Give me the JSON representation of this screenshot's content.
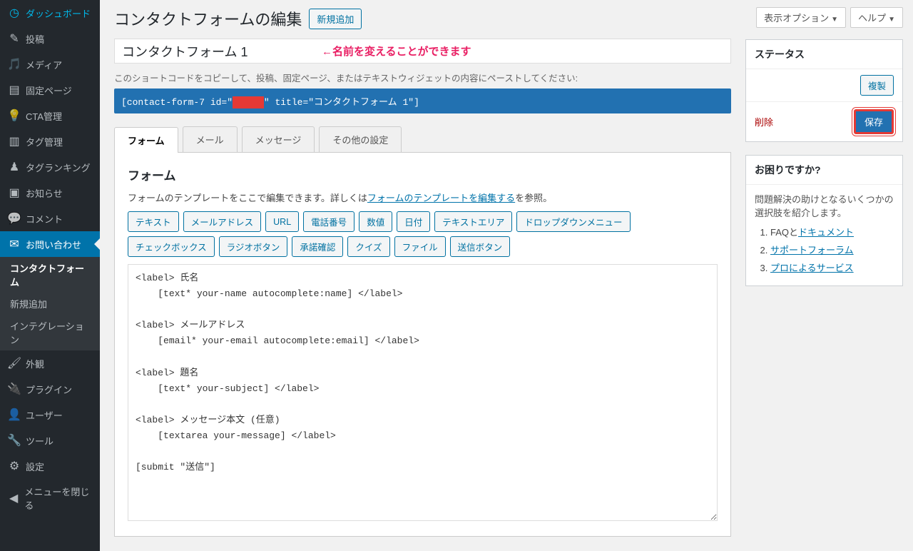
{
  "sidebar": {
    "items": [
      {
        "icon": "◷",
        "label": "ダッシュボード"
      },
      {
        "icon": "✎",
        "label": "投稿"
      },
      {
        "icon": "🎵",
        "label": "メディア"
      },
      {
        "icon": "▤",
        "label": "固定ページ"
      },
      {
        "icon": "💡",
        "label": "CTA管理"
      },
      {
        "icon": "▥",
        "label": "タグ管理"
      },
      {
        "icon": "♟",
        "label": "タグランキング"
      },
      {
        "icon": "▣",
        "label": "お知らせ"
      },
      {
        "icon": "💬",
        "label": "コメント"
      },
      {
        "icon": "✉",
        "label": "お問い合わせ"
      }
    ],
    "sub": {
      "items": [
        {
          "label": "コンタクトフォーム",
          "current": true
        },
        {
          "label": "新規追加"
        },
        {
          "label": "インテグレーション"
        }
      ]
    },
    "items2": [
      {
        "icon": "🖌",
        "label": "外観"
      },
      {
        "icon": "🔌",
        "label": "プラグイン"
      },
      {
        "icon": "👤",
        "label": "ユーザー"
      },
      {
        "icon": "🔧",
        "label": "ツール"
      },
      {
        "icon": "⚙",
        "label": "設定"
      },
      {
        "icon": "◀",
        "label": "メニューを閉じる"
      }
    ]
  },
  "topbar": {
    "screenOptions": "表示オプション",
    "help": "ヘルプ"
  },
  "page": {
    "title": "コンタクトフォームの編集",
    "addNew": "新規追加",
    "formTitle": "コンタクトフォーム 1",
    "annotation": "←名前を変えることができます",
    "shortcodeDesc": "このショートコードをコピーして、投稿、固定ページ、またはテキストウィジェットの内容にペーストしてください:",
    "shortcodePre": "[contact-form-7 id=\"",
    "shortcodePost": "\" title=\"コンタクトフォーム 1\"]"
  },
  "tabs": [
    "フォーム",
    "メール",
    "メッセージ",
    "その他の設定"
  ],
  "panel": {
    "title": "フォーム",
    "descPre": "フォームのテンプレートをここで編集できます。詳しくは",
    "descLink": "フォームのテンプレートを編集する",
    "descPost": "を参照。",
    "tagButtons": [
      "テキスト",
      "メールアドレス",
      "URL",
      "電話番号",
      "数値",
      "日付",
      "テキストエリア",
      "ドロップダウンメニュー",
      "チェックボックス",
      "ラジオボタン",
      "承諾確認",
      "クイズ",
      "ファイル",
      "送信ボタン"
    ],
    "formContent": "<label> 氏名\n    [text* your-name autocomplete:name] </label>\n\n<label> メールアドレス\n    [email* your-email autocomplete:email] </label>\n\n<label> 題名\n    [text* your-subject] </label>\n\n<label> メッセージ本文 (任意)\n    [textarea your-message] </label>\n\n[submit \"送信\"]"
  },
  "status": {
    "title": "ステータス",
    "copy": "複製",
    "delete": "削除",
    "save": "保存"
  },
  "help": {
    "title": "お困りですか?",
    "text": "問題解決の助けとなるいくつかの選択肢を紹介します。",
    "links": [
      {
        "pre": "FAQと",
        "link": "ドキュメント"
      },
      {
        "pre": "",
        "link": "サポートフォーラム"
      },
      {
        "pre": "",
        "link": "プロによるサービス"
      }
    ]
  }
}
